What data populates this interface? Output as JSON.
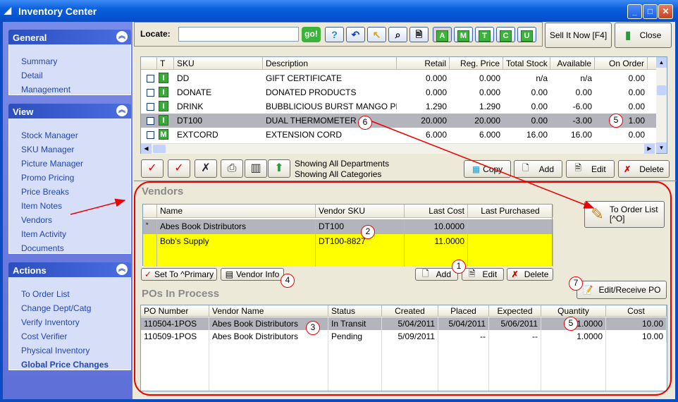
{
  "window": {
    "title": "Inventory Center",
    "minimize": "_",
    "maximize": "□",
    "close": "✕"
  },
  "sidebar": {
    "general": {
      "title": "General",
      "items": [
        "Summary",
        "Detail",
        "Management"
      ]
    },
    "view": {
      "title": "View",
      "items": [
        "Stock Manager",
        "SKU Manager",
        "Picture Manager",
        "Promo Pricing",
        "Price Breaks",
        "Item Notes",
        "Vendors",
        "Item Activity",
        "Documents"
      ]
    },
    "actions": {
      "title": "Actions",
      "items": [
        "To Order List",
        "Change Dept/Catg",
        "Verify Inventory",
        "Cost Verifier",
        "Physical Inventory",
        "Global Price Changes"
      ]
    }
  },
  "toolbar": {
    "locate_label": "Locate:",
    "locate_value": "",
    "go_label": "go!",
    "letter_buttons": [
      "A",
      "M",
      "T",
      "C",
      "U"
    ],
    "sell_it_now": "Sell It Now [F4]",
    "close": "Close"
  },
  "items_grid": {
    "columns": [
      "",
      "T",
      "SKU",
      "Description",
      "Retail",
      "Reg. Price",
      "Total Stock",
      "Available",
      "On Order"
    ],
    "rows": [
      {
        "t": "I",
        "sku": "DD",
        "desc": "GIFT CERTIFICATE",
        "retail": "0.000",
        "reg": "0.000",
        "stock": "n/a",
        "avail": "n/a",
        "order": "0.00"
      },
      {
        "t": "I",
        "sku": "DONATE",
        "desc": "DONATED PRODUCTS",
        "retail": "0.000",
        "reg": "0.000",
        "stock": "0.00",
        "avail": "0.00",
        "order": "0.00"
      },
      {
        "t": "I",
        "sku": "DRINK",
        "desc": "BUBBLICIOUS BURST MANGO PEAC",
        "retail": "1.290",
        "reg": "1.290",
        "stock": "0.00",
        "avail": "-6.00",
        "order": "0.00"
      },
      {
        "t": "I",
        "sku": "DT100",
        "desc": "DUAL THERMOMETER",
        "retail": "20.000",
        "reg": "20.000",
        "stock": "0.00",
        "avail": "-3.00",
        "order": "1.00"
      },
      {
        "t": "M",
        "sku": "EXTCORD",
        "desc": "EXTENSION CORD",
        "retail": "6.000",
        "reg": "6.000",
        "stock": "16.00",
        "avail": "16.00",
        "order": "0.00"
      }
    ]
  },
  "filter": {
    "dept": "Showing All Departments",
    "cat": "Showing All Categories"
  },
  "grid_buttons": {
    "copy": "Copy",
    "add": "Add",
    "edit": "Edit",
    "delete": "Delete"
  },
  "vendors": {
    "title": "Vendors",
    "columns": [
      "",
      "Name",
      "Vendor SKU",
      "Last Cost",
      "Last Purchased"
    ],
    "rows": [
      {
        "mark": "*",
        "name": "Abes Book Distributors",
        "sku": "DT100",
        "cost": "10.0000",
        "last": ""
      },
      {
        "mark": "",
        "name": "Bob's Supply",
        "sku": "DT100-8827",
        "cost": "11.0000",
        "last": ""
      }
    ],
    "set_primary": "Set To ^Primary",
    "vendor_info": "Vendor Info",
    "add": "Add",
    "edit": "Edit",
    "delete": "Delete",
    "to_order_list": "To Order List",
    "to_order_shortcut": "[^O]"
  },
  "pos": {
    "title": "POs In Process",
    "edit_receive": "Edit/Receive PO",
    "columns": [
      "PO Number",
      "Vendor Name",
      "Status",
      "Created",
      "Placed",
      "Expected",
      "Quantity",
      "Cost"
    ],
    "rows": [
      [
        "110504-1POS",
        "Abes Book Distributors",
        "In Transit",
        "5/04/2011",
        "5/04/2011",
        "5/06/2011",
        "1.0000",
        "10.00"
      ],
      [
        "110509-1POS",
        "Abes Book Distributors",
        "Pending",
        "5/09/2011",
        "--",
        "--",
        "1.0000",
        "10.00"
      ]
    ]
  },
  "annotations": [
    "1",
    "2",
    "3",
    "4",
    "5",
    "5",
    "6",
    "7"
  ],
  "colors": {
    "selected_row": "#b4b4bc",
    "highlight_row": "#ffff00",
    "annotation": "#e00000"
  }
}
